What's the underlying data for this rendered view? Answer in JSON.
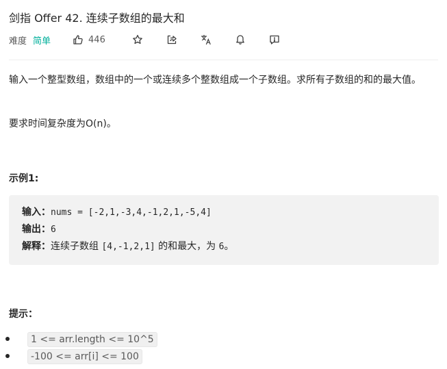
{
  "problem": {
    "title": "剑指 Offer 42. 连续子数组的最大和",
    "difficulty_label": "难度",
    "difficulty": "简单",
    "likes": "446"
  },
  "description": {
    "p1": "输入一个整型数组，数组中的一个或连续多个整数组成一个子数组。求所有子数组的和的最大值。",
    "p2": "要求时间复杂度为O(n)。"
  },
  "example": {
    "heading": "示例1:",
    "input_label": "输入：",
    "input_value": "nums = [-2,1,-3,4,-1,2,1,-5,4]",
    "output_label": "输出：",
    "output_value": "6",
    "explain_label": "解释：",
    "explain_pre": "连续子数组 ",
    "explain_code": "[4,-1,2,1]",
    "explain_mid": " 的和最大，为 ",
    "explain_num": "6",
    "explain_end": "。"
  },
  "hints": {
    "heading": "提示：",
    "items": [
      "1 <= arr.length <= 10^5",
      "-100 <= arr[i] <= 100"
    ]
  },
  "icons": [
    "thumb-up-icon",
    "star-icon",
    "share-icon",
    "translate-icon",
    "bell-icon",
    "feedback-icon"
  ]
}
